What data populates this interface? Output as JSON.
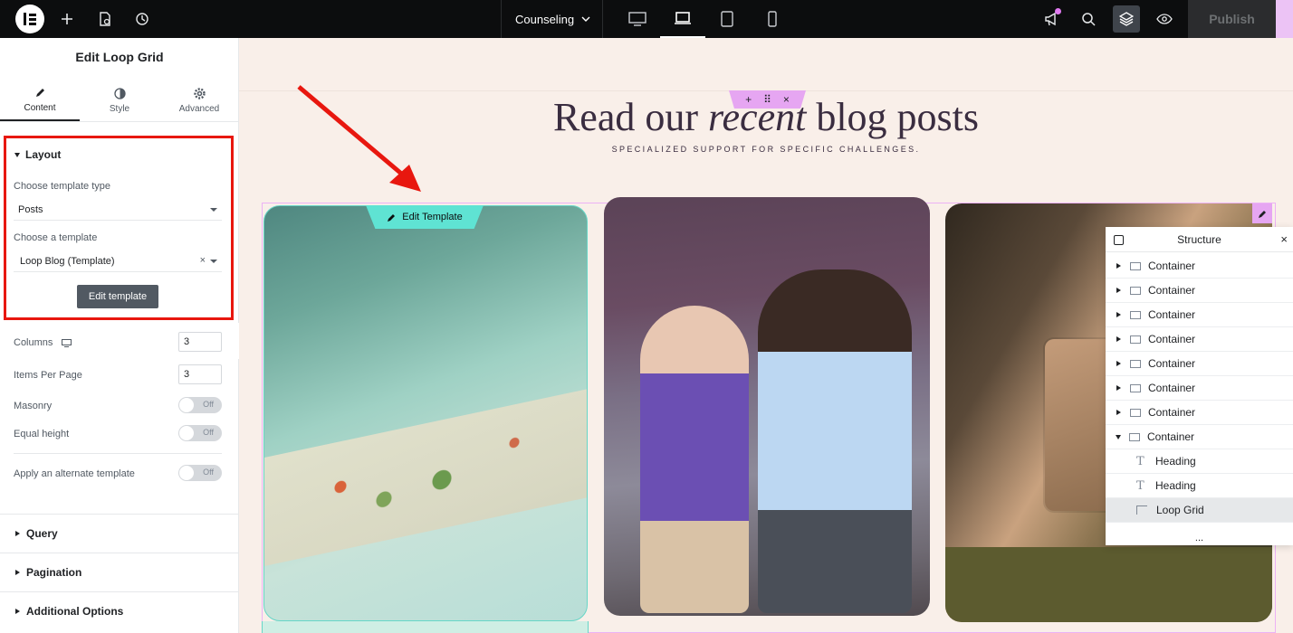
{
  "topbar": {
    "page_name": "Counseling",
    "publish_label": "Publish"
  },
  "panel": {
    "title": "Edit Loop Grid",
    "tabs": [
      {
        "label": "Content",
        "icon": "pencil-icon"
      },
      {
        "label": "Style",
        "icon": "contrast-icon"
      },
      {
        "label": "Advanced",
        "icon": "gear-icon"
      }
    ],
    "layout": {
      "heading": "Layout",
      "template_type_label": "Choose template type",
      "template_type_value": "Posts",
      "template_label": "Choose a template",
      "template_value": "Loop Blog (Template)",
      "clear_symbol": "×",
      "edit_button": "Edit template"
    },
    "settings": {
      "columns_label": "Columns",
      "columns_value": "3",
      "items_per_page_label": "Items Per Page",
      "items_per_page_value": "3",
      "masonry_label": "Masonry",
      "masonry_state": "Off",
      "equal_height_label": "Equal height",
      "equal_height_state": "Off",
      "alternate_label": "Apply an alternate template",
      "alternate_state": "Off"
    },
    "sections": [
      "Query",
      "Pagination",
      "Additional Options"
    ],
    "collapse_symbol": "‹"
  },
  "canvas": {
    "headline_before": "Read our ",
    "headline_em": "recent",
    "headline_after": " blog posts",
    "subline": "SPECIALIZED SUPPORT FOR SPECIFIC CHALLENGES.",
    "section_handle": {
      "add": "+",
      "move": "⠿",
      "close": "×"
    },
    "edit_template_label": "Edit Template"
  },
  "structure": {
    "title": "Structure",
    "close_symbol": "×",
    "rows": [
      {
        "label": "Container"
      },
      {
        "label": "Container"
      },
      {
        "label": "Container"
      },
      {
        "label": "Container"
      },
      {
        "label": "Container"
      },
      {
        "label": "Container"
      },
      {
        "label": "Container"
      },
      {
        "label": "Container"
      },
      {
        "label": "Heading"
      },
      {
        "label": "Heading"
      },
      {
        "label": "Loop Grid"
      }
    ],
    "more": "..."
  },
  "colors": {
    "accent_teal": "#5fe3d3",
    "accent_pink": "#e6a6f2",
    "highlight_red": "#e8170f",
    "canvas_bg": "#f9efe9"
  }
}
